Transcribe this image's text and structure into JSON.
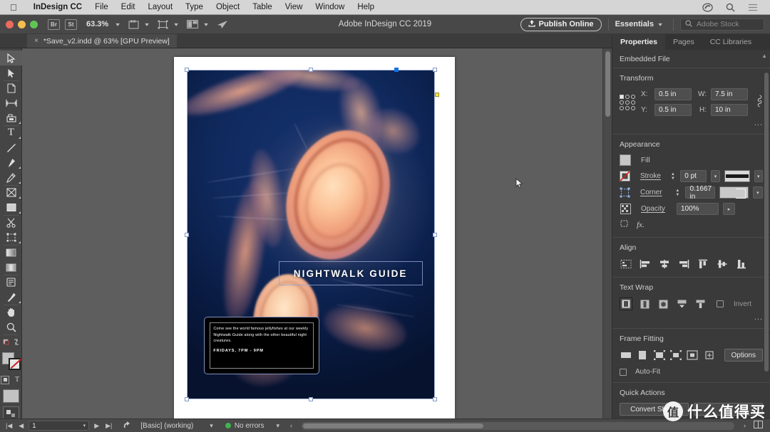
{
  "macmenu": {
    "apple": "apple-logo",
    "items": [
      {
        "label": "InDesign CC",
        "bold": true
      },
      {
        "label": "File"
      },
      {
        "label": "Edit"
      },
      {
        "label": "Layout"
      },
      {
        "label": "Type"
      },
      {
        "label": "Object"
      },
      {
        "label": "Table"
      },
      {
        "label": "View"
      },
      {
        "label": "Window"
      },
      {
        "label": "Help"
      }
    ],
    "right_icons": [
      "creative-cloud-icon",
      "search-icon",
      "menu-list-icon"
    ]
  },
  "appbar": {
    "bridge_label": "Br",
    "stock_label": "St",
    "zoom_level": "63.3%",
    "title": "Adobe InDesign CC 2019",
    "publish_label": "Publish Online",
    "workspace": "Essentials",
    "stock_placeholder": "Adobe Stock"
  },
  "tab": {
    "close": "×",
    "title": "*Save_v2.indd @ 63% [GPU Preview]"
  },
  "tools": [
    {
      "name": "selection-tool",
      "glyph": "selection",
      "selected": true,
      "group_start": false,
      "has_flyout": false
    },
    {
      "name": "direct-selection-tool",
      "glyph": "direct",
      "selected": false,
      "group_start": false,
      "has_flyout": false
    },
    {
      "name": "page-tool",
      "glyph": "page",
      "selected": false,
      "group_start": true,
      "has_flyout": false
    },
    {
      "name": "gap-tool",
      "glyph": "gap",
      "selected": false,
      "group_start": false,
      "has_flyout": false
    },
    {
      "name": "content-collector-tool",
      "glyph": "collector",
      "selected": false,
      "group_start": false,
      "has_flyout": true
    },
    {
      "name": "type-tool",
      "glyph": "type",
      "selected": false,
      "group_start": true,
      "has_flyout": true
    },
    {
      "name": "line-tool",
      "glyph": "line",
      "selected": false,
      "group_start": false,
      "has_flyout": false
    },
    {
      "name": "pen-tool",
      "glyph": "pen",
      "selected": false,
      "group_start": false,
      "has_flyout": true
    },
    {
      "name": "pencil-tool",
      "glyph": "pencil",
      "selected": false,
      "group_start": false,
      "has_flyout": true
    },
    {
      "name": "frame-tool",
      "glyph": "frame-x",
      "selected": false,
      "group_start": true,
      "has_flyout": true
    },
    {
      "name": "rectangle-tool",
      "glyph": "rect",
      "selected": false,
      "group_start": false,
      "has_flyout": true
    },
    {
      "name": "scissors-tool",
      "glyph": "scissors",
      "selected": false,
      "group_start": true,
      "has_flyout": false
    },
    {
      "name": "free-transform-tool",
      "glyph": "transform",
      "selected": false,
      "group_start": false,
      "has_flyout": true
    },
    {
      "name": "gradient-swatch-tool",
      "glyph": "gradient",
      "selected": false,
      "group_start": true,
      "has_flyout": false
    },
    {
      "name": "gradient-feather-tool",
      "glyph": "feather",
      "selected": false,
      "group_start": false,
      "has_flyout": false
    },
    {
      "name": "note-tool",
      "glyph": "note",
      "selected": false,
      "group_start": true,
      "has_flyout": false
    },
    {
      "name": "eyedropper-tool",
      "glyph": "eyedropper",
      "selected": false,
      "group_start": false,
      "has_flyout": true
    },
    {
      "name": "hand-tool",
      "glyph": "hand",
      "selected": false,
      "group_start": true,
      "has_flyout": false
    },
    {
      "name": "zoom-tool",
      "glyph": "zoom",
      "selected": false,
      "group_start": false,
      "has_flyout": false
    }
  ],
  "tool_extras": {
    "fill_stroke": "fill-stroke-swatches",
    "swap_icon": "swap-fill-stroke-icon",
    "default_icon": "default-fill-stroke-icon",
    "formatting_frame": "formatting-affects-container-icon",
    "formatting_text": "formatting-affects-text-icon",
    "apply_color": "apply-color-swatch",
    "apply_none": "apply-none-swatch"
  },
  "document": {
    "title_text": "NIGHTWALK GUIDE",
    "body_text": "Come see the world famous jellyfishes at our weekly Nightwalk Guide along with the other beautiful night creatures.",
    "hours_text": "FRIDAYS, 7PM - 9PM",
    "image_alt": "jellyfish-photo",
    "bg_color": "#0a1d47"
  },
  "properties": {
    "tabs": [
      {
        "label": "Properties",
        "active": true
      },
      {
        "label": "Pages",
        "active": false
      },
      {
        "label": "CC Libraries",
        "active": false
      }
    ],
    "subtitle": "Embedded File",
    "transform": {
      "heading": "Transform",
      "x_label": "X:",
      "x_value": "0.5 in",
      "y_label": "Y:",
      "y_value": "0.5 in",
      "w_label": "W:",
      "w_value": "7.5 in",
      "h_label": "H:",
      "h_value": "10 in",
      "link_icon": "constrain-proportions-icon",
      "reference_point": "reference-point-selector",
      "more_options": "..."
    },
    "appearance": {
      "heading": "Appearance",
      "fill_label": "Fill",
      "stroke_label": "Stroke",
      "stroke_weight": "0 pt",
      "corner_label": "Corner",
      "corner_value": "0.1667 in",
      "opacity_label": "Opacity",
      "opacity_value": "100%",
      "effects_label": "fx."
    },
    "align": {
      "heading": "Align",
      "buttons": [
        "align-reference-icon",
        "align-left-icon",
        "align-horizontal-center-icon",
        "align-right-icon",
        "align-top-icon",
        "align-vertical-center-icon",
        "align-bottom-icon"
      ]
    },
    "textwrap": {
      "heading": "Text Wrap",
      "buttons": [
        "wrap-none-icon",
        "wrap-bounding-box-icon",
        "wrap-object-shape-icon",
        "wrap-jump-object-icon",
        "wrap-next-column-icon"
      ],
      "invert_label": "Invert",
      "more": "..."
    },
    "framefitting": {
      "heading": "Frame Fitting",
      "buttons": [
        "fit-content-proportionally-icon",
        "fill-frame-proportionally-icon",
        "fit-content-to-frame-icon",
        "fit-frame-to-content-icon",
        "center-content-icon",
        "content-aware-fit-icon"
      ],
      "options_label": "Options",
      "autofit_label": "Auto-Fit"
    },
    "quickactions": {
      "heading": "Quick Actions",
      "button_label": "Convert Shape"
    }
  },
  "statusbar": {
    "page_value": "1",
    "style_value": "[Basic] (working)",
    "errors_text": "No errors",
    "first_icon": "first-page-icon",
    "prev_icon": "previous-page-icon",
    "next_icon": "next-page-icon",
    "last_icon": "last-page-icon",
    "preflight_icon": "preflight-icon",
    "error_color": "#3eb34f"
  },
  "watermark": {
    "mark": "值",
    "text": "什么值得买"
  }
}
